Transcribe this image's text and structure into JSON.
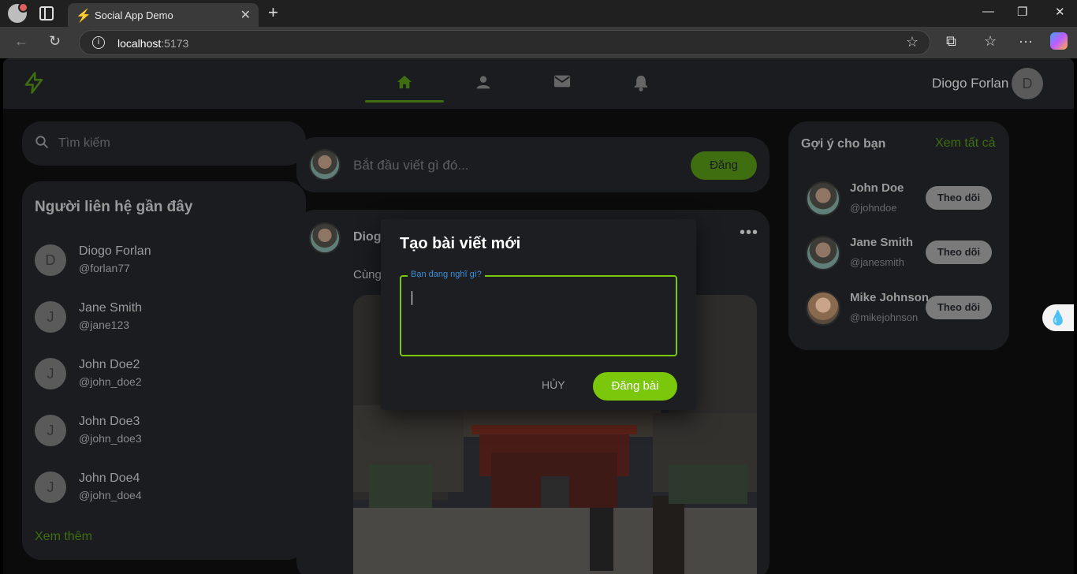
{
  "browser": {
    "tab_title": "Social App Demo",
    "url_host": "localhost",
    "url_port": ":5173"
  },
  "app": {
    "user_name": "Diogo Forlan",
    "user_initial": "D",
    "nav": [
      "home-icon",
      "person-icon",
      "mail-icon",
      "bell-icon"
    ],
    "active_nav": "home"
  },
  "search": {
    "placeholder": "Tìm kiếm"
  },
  "contacts": {
    "title": "Người liên hệ gần đây",
    "items": [
      {
        "initial": "D",
        "name": "Diogo Forlan",
        "handle": "@forlan77"
      },
      {
        "initial": "J",
        "name": "Jane Smith",
        "handle": "@jane123"
      },
      {
        "initial": "J",
        "name": "John Doe2",
        "handle": "@john_doe2"
      },
      {
        "initial": "J",
        "name": "John Doe3",
        "handle": "@john_doe3"
      },
      {
        "initial": "J",
        "name": "John Doe4",
        "handle": "@john_doe4"
      }
    ],
    "see_more": "Xem thêm"
  },
  "composer": {
    "placeholder": "Bắt đầu viết gì đó...",
    "post_label": "Đăng"
  },
  "post": {
    "author": "Diogo",
    "caption": "Cùng"
  },
  "suggestions": {
    "title": "Gợi ý cho bạn",
    "see_all": "Xem tất cả",
    "items": [
      {
        "name": "John Doe",
        "handle": "@johndoe",
        "follow": "Theo dõi"
      },
      {
        "name": "Jane Smith",
        "handle": "@janesmith",
        "follow": "Theo dõi"
      },
      {
        "name": "Mike Johnson",
        "handle": "@mikejohnson",
        "follow": "Theo dõi"
      }
    ]
  },
  "modal": {
    "title": "Tạo bài viết mới",
    "field_label": "Bạn đang nghĩ gì?",
    "field_value": "",
    "cancel": "HỦY",
    "submit": "Đăng bài"
  },
  "colors": {
    "accent": "#7ac70c",
    "accent_dim": "#3e6e10",
    "panel": "#1a1c20",
    "label_blue": "#3d8fd6"
  }
}
